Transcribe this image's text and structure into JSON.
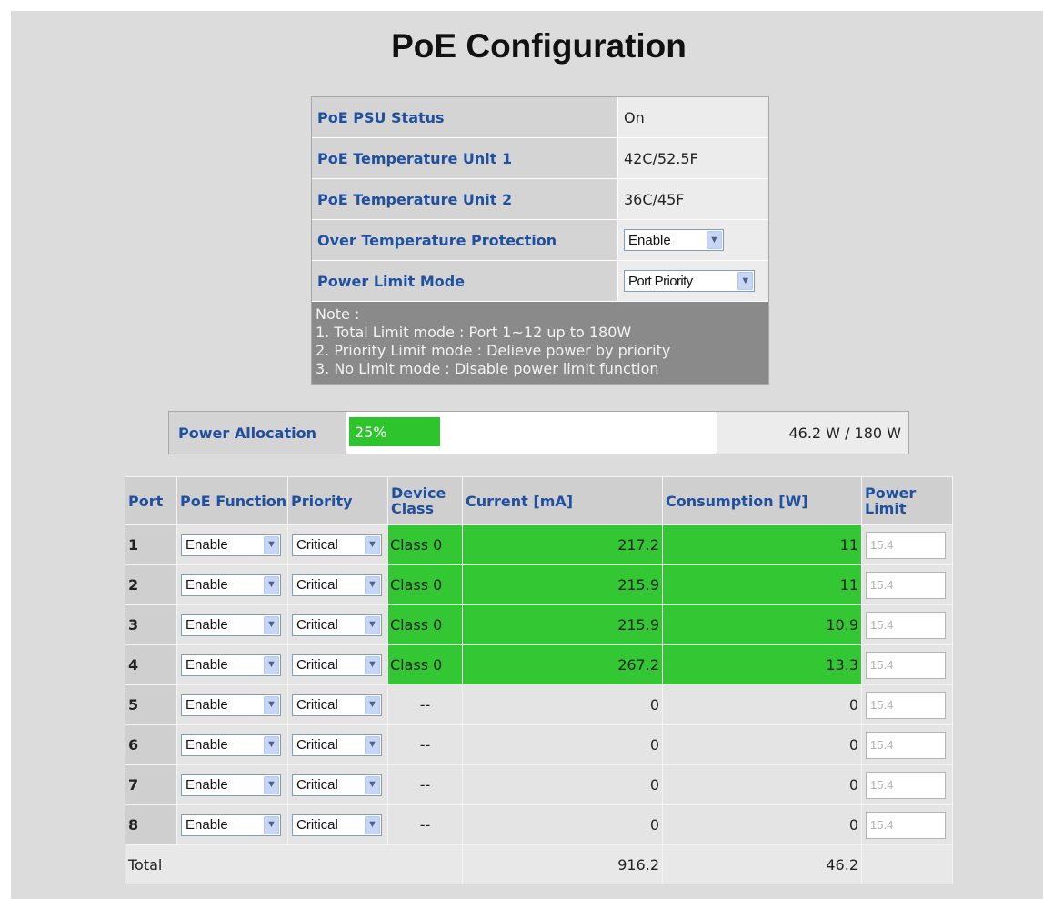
{
  "title": "PoE Configuration",
  "status": {
    "rows": [
      {
        "label": "PoE PSU Status",
        "value": "On"
      },
      {
        "label": "PoE Temperature Unit 1",
        "value": "42C/52.5F"
      },
      {
        "label": "PoE Temperature Unit 2",
        "value": "36C/45F"
      }
    ],
    "over_temp": {
      "label": "Over Temperature Protection",
      "value": "Enable"
    },
    "power_limit_mode": {
      "label": "Power Limit Mode",
      "value": "Port Priority"
    },
    "note": [
      "Note :",
      "1. Total Limit mode : Port 1~12 up to 180W",
      "2. Priority Limit mode : Delieve power by priority",
      "3. No Limit mode : Disable power limit function"
    ]
  },
  "allocation": {
    "label": "Power Allocation",
    "percent_label": "25%",
    "fraction": 0.25,
    "total": "46.2 W / 180 W"
  },
  "ports": {
    "headers": [
      "Port",
      "PoE Function",
      "Priority",
      "Device Class",
      "Current [mA]",
      "Consumption [W]",
      "Power Limit"
    ],
    "rows": [
      {
        "port": "1",
        "function": "Enable",
        "priority": "Critical",
        "class": "Class 0",
        "current": "217.2",
        "consumption": "11",
        "limit": "15.4",
        "active": true
      },
      {
        "port": "2",
        "function": "Enable",
        "priority": "Critical",
        "class": "Class 0",
        "current": "215.9",
        "consumption": "11",
        "limit": "15.4",
        "active": true
      },
      {
        "port": "3",
        "function": "Enable",
        "priority": "Critical",
        "class": "Class 0",
        "current": "215.9",
        "consumption": "10.9",
        "limit": "15.4",
        "active": true
      },
      {
        "port": "4",
        "function": "Enable",
        "priority": "Critical",
        "class": "Class 0",
        "current": "267.2",
        "consumption": "13.3",
        "limit": "15.4",
        "active": true
      },
      {
        "port": "5",
        "function": "Enable",
        "priority": "Critical",
        "class": "--",
        "current": "0",
        "consumption": "0",
        "limit": "15.4",
        "active": false
      },
      {
        "port": "6",
        "function": "Enable",
        "priority": "Critical",
        "class": "--",
        "current": "0",
        "consumption": "0",
        "limit": "15.4",
        "active": false
      },
      {
        "port": "7",
        "function": "Enable",
        "priority": "Critical",
        "class": "--",
        "current": "0",
        "consumption": "0",
        "limit": "15.4",
        "active": false
      },
      {
        "port": "8",
        "function": "Enable",
        "priority": "Critical",
        "class": "--",
        "current": "0",
        "consumption": "0",
        "limit": "15.4",
        "active": false
      }
    ],
    "total": {
      "label": "Total",
      "current": "916.2",
      "consumption": "46.2"
    }
  },
  "colors": {
    "active_green": "#33c833",
    "label_blue": "#2050a0",
    "note_bg": "#8a8a8a"
  }
}
